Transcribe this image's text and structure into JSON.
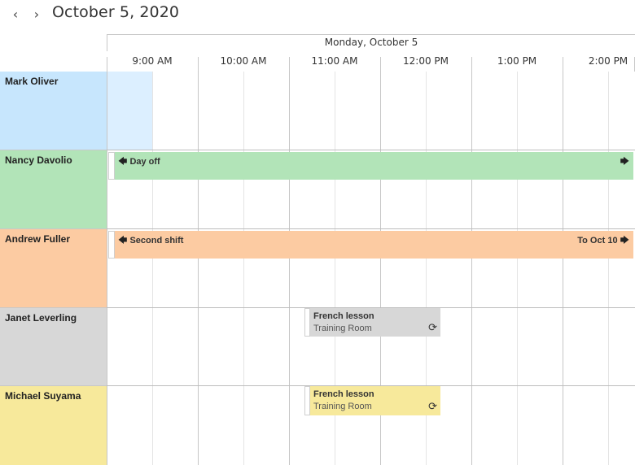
{
  "header": {
    "prev_glyph": "‹",
    "next_glyph": "›",
    "title": "October 5, 2020"
  },
  "day_header": "Monday, October 5",
  "time_labels": [
    "9:00 AM",
    "10:00 AM",
    "11:00 AM",
    "12:00 PM",
    "1:00 PM",
    "2:00 PM"
  ],
  "resources": [
    {
      "name": "Mark Oliver",
      "color": "#c7e6fd"
    },
    {
      "name": "Nancy Davolio",
      "color": "#b2e4b8"
    },
    {
      "name": "Andrew Fuller",
      "color": "#fccba2"
    },
    {
      "name": "Janet Leverling",
      "color": "#d7d7d7"
    },
    {
      "name": "Michael Suyama",
      "color": "#f7e99b"
    }
  ],
  "highlight_color": "#dcefff",
  "appointments": [
    {
      "title": "Day off",
      "continues_left": true,
      "continues_right": true,
      "color": "#b2e4b8"
    },
    {
      "title": "Second shift",
      "end_note": "To Oct 10",
      "continues_left": true,
      "continues_right": true,
      "color": "#fccba2"
    },
    {
      "title": "French lesson",
      "location": "Training Room",
      "recurring": true,
      "color": "#d7d7d7"
    },
    {
      "title": "French lesson",
      "location": "Training Room",
      "recurring": true,
      "color": "#f7e99b"
    }
  ]
}
